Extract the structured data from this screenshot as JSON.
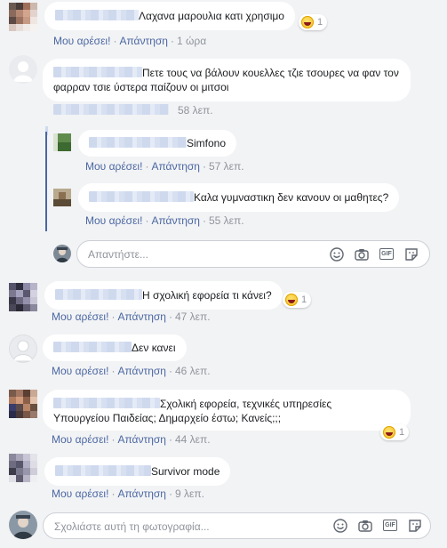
{
  "comments": [
    {
      "id": "c1",
      "text": "Λαχανα μαρουλια κατι χρησιμο",
      "like": "Μου αρέσει!",
      "reply": "Απάντηση",
      "time": "1 ώρα",
      "reaction_count": "1"
    },
    {
      "id": "c2",
      "text": "Πετε τους να βάλουν κουελλες τζιε τσουρες να φαν τον φαρραν τσιε ύστερα παίζουν οι μιτσοι",
      "time": "58 λεπ."
    },
    {
      "id": "r1",
      "text": "Simfono",
      "like": "Μου αρέσει!",
      "reply": "Απάντηση",
      "time": "57 λεπ."
    },
    {
      "id": "r2",
      "text": "Καλα γυμναστικη δεν κανουν οι μαθητες?",
      "like": "Μου αρέσει!",
      "reply": "Απάντηση",
      "time": "55 λεπ."
    },
    {
      "id": "c3",
      "text": "Η σχολική εφορεία τι κάνει?",
      "like": "Μου αρέσει!",
      "reply": "Απάντηση",
      "time": "47 λεπ.",
      "reaction_count": "1"
    },
    {
      "id": "c4",
      "text": "Δεν κανει",
      "like": "Μου αρέσει!",
      "reply": "Απάντηση",
      "time": "46 λεπ."
    },
    {
      "id": "c5",
      "text_line1": "Σχολική εφορεία, τεχνικές υπηρεσίες",
      "text_line2": "Υπουργείου Παιδείας; Δημαρχείο έστω; Κανείς;;;",
      "like": "Μου αρέσει!",
      "reply": "Απάντηση",
      "time": "44 λεπ.",
      "reaction_count": "1"
    },
    {
      "id": "c6",
      "text": "Survivor mode",
      "like": "Μου αρέσει!",
      "reply": "Απάντηση",
      "time": "9 λεπ."
    }
  ],
  "reply_box": {
    "placeholder": "Απαντήστε..."
  },
  "comment_box": {
    "placeholder": "Σχολιάστε αυτή τη φωτογραφία..."
  },
  "icons": {
    "emoji": "smiley-icon",
    "camera": "camera-icon",
    "gif": "GIF",
    "sticker": "sticker-icon"
  },
  "colors": {
    "link": "#4b67a1",
    "meta": "#90949c",
    "background": "#f2f3f5",
    "bubble": "#ffffff"
  }
}
